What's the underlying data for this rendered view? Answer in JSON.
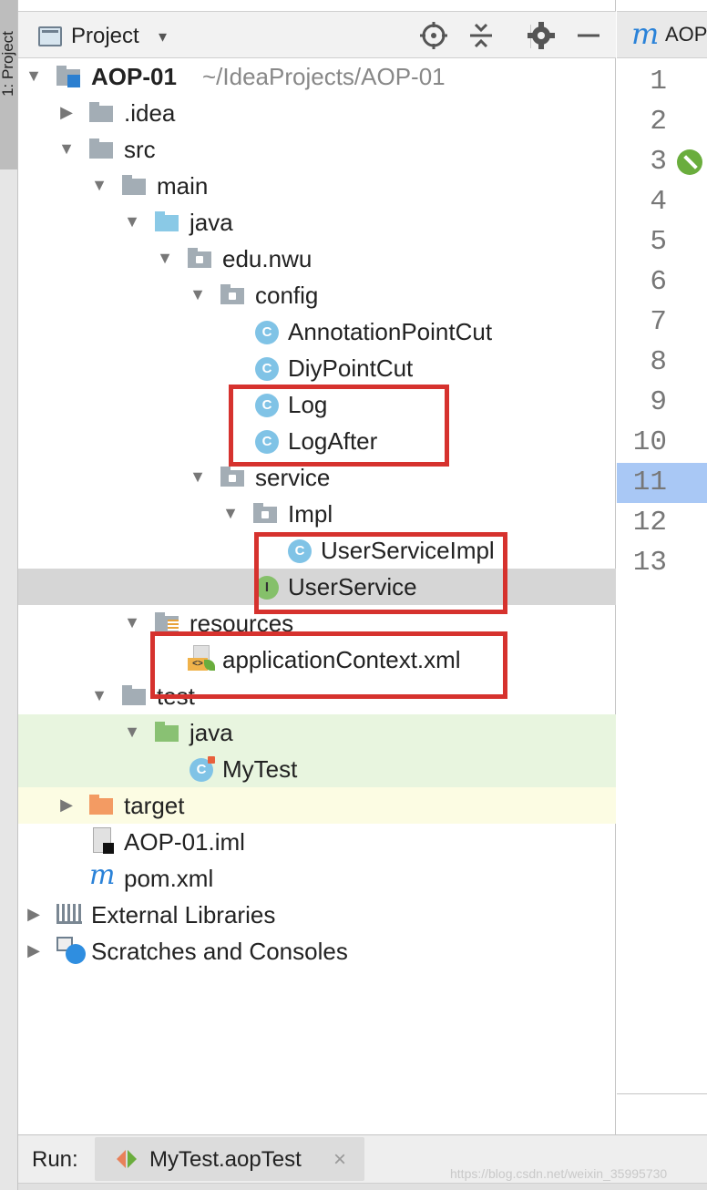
{
  "side_tab": {
    "label": "1: Project"
  },
  "panel": {
    "title": "Project",
    "chevron": "▾"
  },
  "toolbar_icons": [
    "crosshair-icon",
    "collapse-all-icon",
    "gear-icon",
    "minimize-icon"
  ],
  "tree": [
    {
      "label": "AOP-01",
      "path": "~/IdeaProjects/AOP-01",
      "icon": "module-folder-icon",
      "expanded": true
    },
    {
      "label": ".idea",
      "icon": "folder-icon",
      "expanded": false
    },
    {
      "label": "src",
      "icon": "folder-icon",
      "expanded": true
    },
    {
      "label": "main",
      "icon": "folder-icon",
      "expanded": true
    },
    {
      "label": "java",
      "icon": "source-folder-icon",
      "expanded": true
    },
    {
      "label": "edu.nwu",
      "icon": "package-icon",
      "expanded": true
    },
    {
      "label": "config",
      "icon": "package-icon",
      "expanded": true
    },
    {
      "label": "AnnotationPointCut",
      "icon": "class-icon",
      "badge": "C"
    },
    {
      "label": "DiyPointCut",
      "icon": "class-icon",
      "badge": "C"
    },
    {
      "label": "Log",
      "icon": "class-icon",
      "badge": "C"
    },
    {
      "label": "LogAfter",
      "icon": "class-icon",
      "badge": "C"
    },
    {
      "label": "service",
      "icon": "package-icon",
      "expanded": true
    },
    {
      "label": "Impl",
      "icon": "package-icon",
      "expanded": true
    },
    {
      "label": "UserServiceImpl",
      "icon": "class-icon",
      "badge": "C"
    },
    {
      "label": "UserService",
      "icon": "interface-icon",
      "badge": "I",
      "selected": true
    },
    {
      "label": "resources",
      "icon": "resources-folder-icon",
      "expanded": true
    },
    {
      "label": "applicationContext.xml",
      "icon": "spring-xml-icon"
    },
    {
      "label": "test",
      "icon": "folder-icon",
      "expanded": true
    },
    {
      "label": "java",
      "icon": "test-folder-icon",
      "expanded": true
    },
    {
      "label": "MyTest",
      "icon": "test-class-icon",
      "badge": "C"
    },
    {
      "label": "target",
      "icon": "excluded-folder-icon",
      "expanded": false
    },
    {
      "label": "AOP-01.iml",
      "icon": "iml-file-icon"
    },
    {
      "label": "pom.xml",
      "icon": "maven-icon"
    },
    {
      "label": "External Libraries",
      "icon": "library-icon",
      "expanded": false
    },
    {
      "label": "Scratches and Consoles",
      "icon": "scratches-icon",
      "expanded": false
    }
  ],
  "editor": {
    "tab_label": "AOP",
    "tab_icon": "maven-icon",
    "line_numbers": [
      "1",
      "2",
      "3",
      "4",
      "5",
      "6",
      "7",
      "8",
      "9",
      "10",
      "11",
      "12",
      "13"
    ],
    "current_line": "11"
  },
  "run_bar": {
    "label": "Run:",
    "tab_label": "MyTest.aopTest",
    "close": "×",
    "watermark": "https://blog.csdn.net/weixin_35995730"
  },
  "colors": {
    "highlight_frame": "#d6322e",
    "selected_row": "#d6d6d6",
    "test_row": "#e8f5df",
    "target_row": "#fcfce3",
    "current_line": "#a9c8f5"
  }
}
